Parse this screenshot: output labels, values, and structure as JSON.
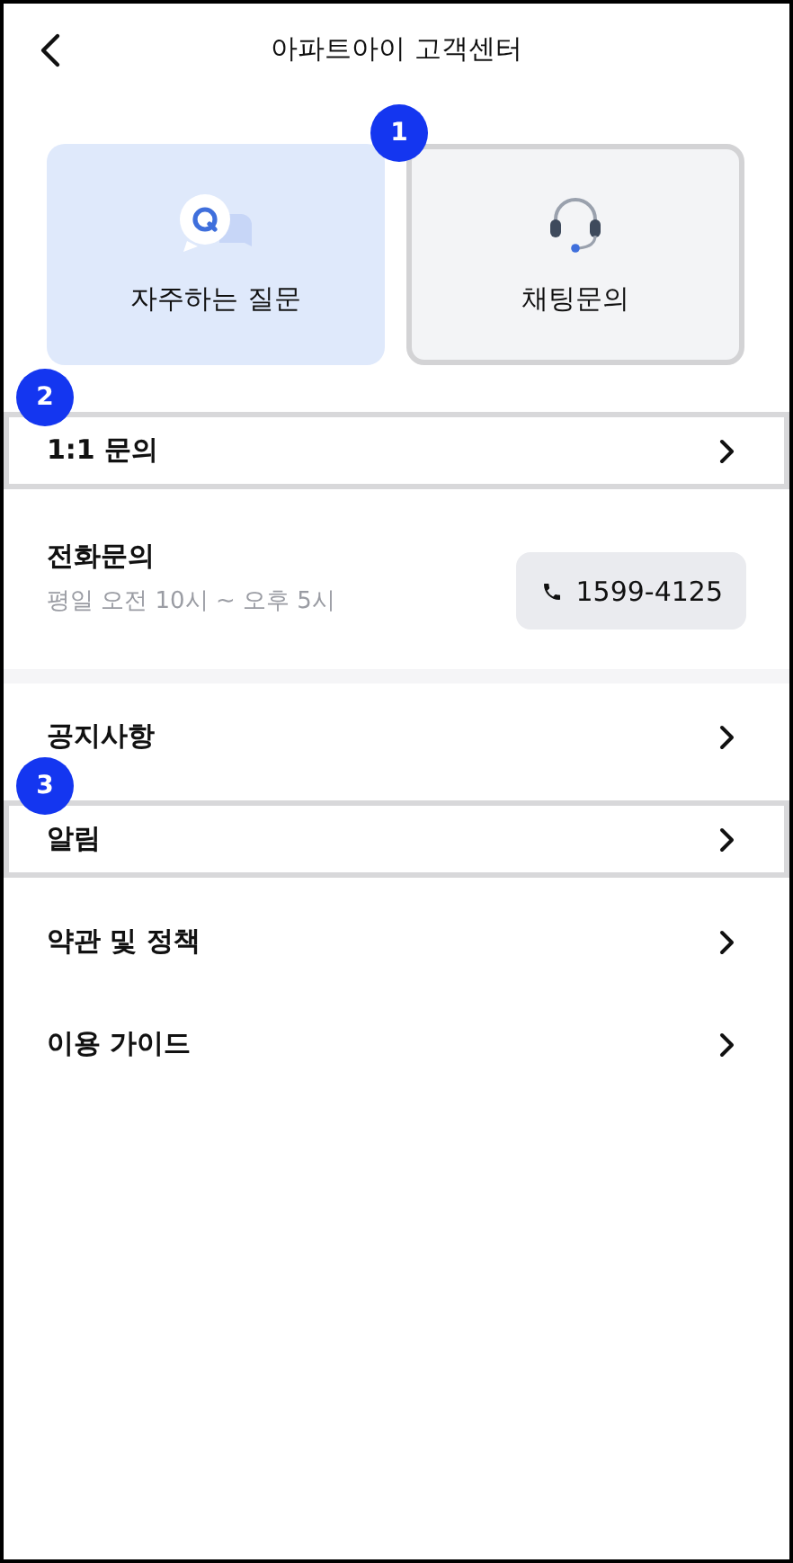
{
  "header": {
    "title": "아파트아이 고객센터"
  },
  "cards": [
    {
      "kind": "faq",
      "label": "자주하는 질문",
      "highlighted": false
    },
    {
      "kind": "chat",
      "label": "채팅문의",
      "highlighted": true,
      "marker": "1"
    }
  ],
  "sections": [
    {
      "rows": [
        {
          "kind": "link",
          "label": "1:1 문의",
          "highlighted": true,
          "marker": "2"
        },
        {
          "kind": "phone",
          "label": "전화문의",
          "hours": "평일 오전 10시 ~ 오후 5시",
          "phone": "1599-4125"
        }
      ]
    },
    {
      "rows": [
        {
          "kind": "link",
          "label": "공지사항",
          "highlighted": false
        },
        {
          "kind": "link",
          "label": "알림",
          "highlighted": true,
          "marker": "3"
        },
        {
          "kind": "link",
          "label": "약관 및 정책",
          "highlighted": false
        },
        {
          "kind": "link",
          "label": "이용 가이드",
          "highlighted": false
        }
      ]
    }
  ]
}
